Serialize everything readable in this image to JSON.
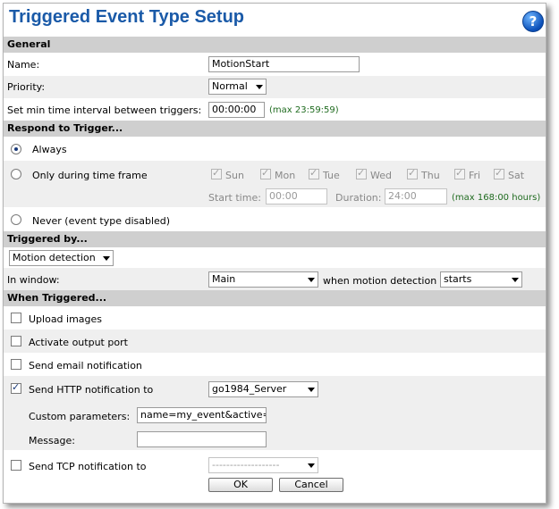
{
  "title": "Triggered Event Type Setup",
  "help_icon": "?",
  "general": {
    "header": "General",
    "name_label": "Name:",
    "name_value": "MotionStart",
    "priority_label": "Priority:",
    "priority_value": "Normal",
    "interval_label": "Set min time interval between triggers:",
    "interval_value": "00:00:00",
    "interval_max": "(max 23:59:59)"
  },
  "respond": {
    "header": "Respond to Trigger...",
    "always_label": "Always",
    "timeframe_label": "Only during time frame",
    "days": [
      "Sun",
      "Mon",
      "Tue",
      "Wed",
      "Thu",
      "Fri",
      "Sat"
    ],
    "start_label": "Start time:",
    "start_value": "00:00",
    "duration_label": "Duration:",
    "duration_value": "24:00",
    "duration_max": "(max 168:00 hours)",
    "never_label": "Never (event type disabled)"
  },
  "triggered_by": {
    "header": "Triggered by...",
    "type_value": "Motion detection",
    "window_label": "In window:",
    "window_value": "Main",
    "when_label": "when motion detection",
    "when_value": "starts"
  },
  "when_triggered": {
    "header": "When Triggered...",
    "upload_label": "Upload images",
    "output_label": "Activate output port",
    "email_label": "Send email notification",
    "http_label": "Send HTTP notification to",
    "http_server": "go1984_Server",
    "custom_label": "Custom parameters:",
    "custom_value": "name=my_event&active=",
    "message_label": "Message:",
    "message_value": "",
    "tcp_label": "Send TCP notification to",
    "tcp_value": "-------------------"
  },
  "buttons": {
    "ok": "OK",
    "cancel": "Cancel"
  }
}
